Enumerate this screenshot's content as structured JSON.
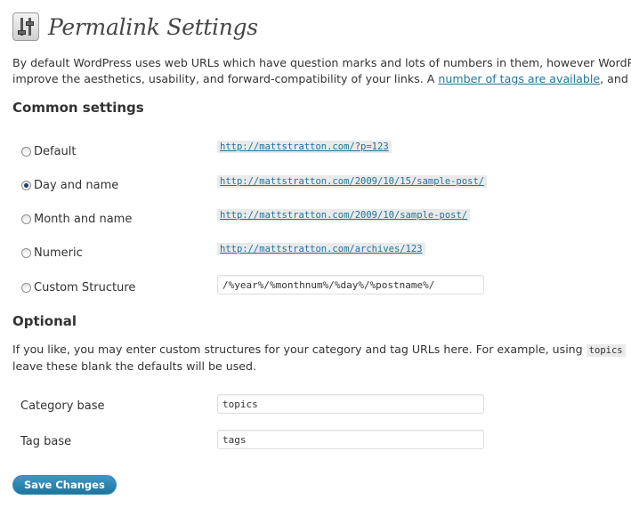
{
  "header": {
    "title": "Permalink Settings",
    "icon": "settings-sliders-icon"
  },
  "intro": {
    "line1": "By default WordPress uses web URLs which have question marks and lots of numbers in them, however WordP",
    "line2_before": "improve the aesthetics, usability, and forward-compatibility of your links. A ",
    "link_text": "number of tags are available",
    "line2_after": ", and h"
  },
  "common": {
    "heading": "Common settings",
    "options": [
      {
        "label": "Default",
        "url": "http://mattstratton.com/?p=123",
        "checked": false
      },
      {
        "label": "Day and name",
        "url": "http://mattstratton.com/2009/10/15/sample-post/",
        "checked": true
      },
      {
        "label": "Month and name",
        "url": "http://mattstratton.com/2009/10/sample-post/",
        "checked": false
      },
      {
        "label": "Numeric",
        "url": "http://mattstratton.com/archives/123",
        "checked": false
      },
      {
        "label": "Custom Structure",
        "value": "/%year%/%monthnum%/%day%/%postname%/",
        "checked": false
      }
    ]
  },
  "optional": {
    "heading": "Optional",
    "line1_before": "If you like, you may enter custom structures for your category and tag URLs here. For example, using ",
    "line1_code": "topics",
    "line2": "leave these blank the defaults will be used.",
    "category_label": "Category base",
    "category_value": "topics",
    "tag_label": "Tag base",
    "tag_value": "tags"
  },
  "save_button": "Save Changes"
}
